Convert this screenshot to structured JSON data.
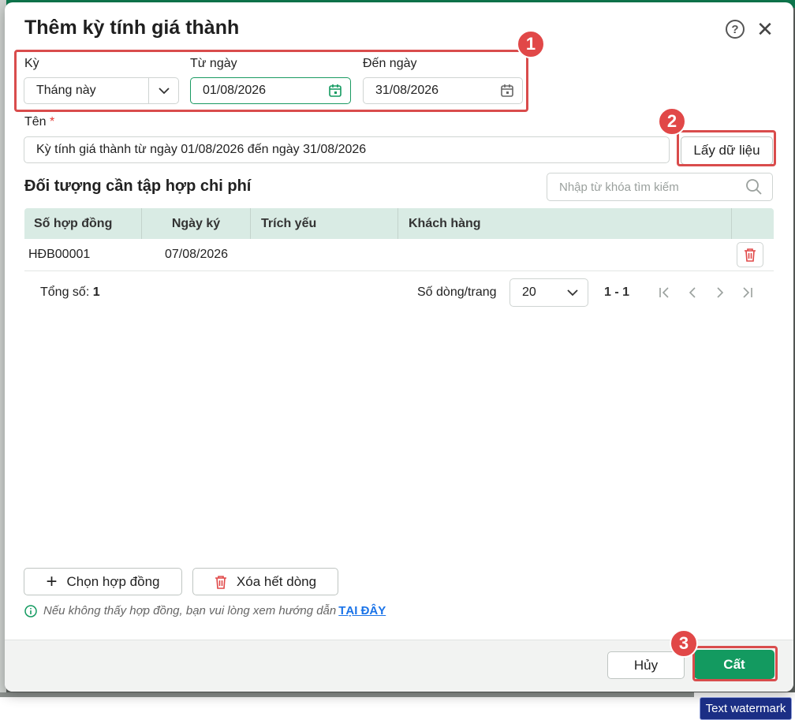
{
  "dialog": {
    "title": "Thêm kỳ tính giá thành",
    "help_icon": "?",
    "close_icon": "✕"
  },
  "period": {
    "ky_label": "Kỳ",
    "ky_value": "Tháng này",
    "from_label": "Từ ngày",
    "from_value": "01/08/2026",
    "to_label": "Đến ngày",
    "to_value": "31/08/2026"
  },
  "name": {
    "label": "Tên",
    "required_mark": "*",
    "value": "Kỳ tính giá thành từ ngày 01/08/2026 đến ngày 31/08/2026",
    "fetch_button": "Lấy dữ liệu"
  },
  "objects": {
    "section_title": "Đối tượng cần tập hợp chi phí",
    "search_placeholder": "Nhập từ khóa tìm kiếm",
    "columns": [
      "Số hợp đồng",
      "Ngày ký",
      "Trích yếu",
      "Khách hàng"
    ],
    "rows": [
      {
        "so_hop_dong": "HĐB00001",
        "ngay_ky": "07/08/2026",
        "trich_yeu": "",
        "khach_hang": ""
      }
    ]
  },
  "pager": {
    "total_label": "Tổng số:",
    "total_value": "1",
    "rows_per_page_label": "Số dòng/trang",
    "rows_per_page_value": "20",
    "range": "1 - 1"
  },
  "actions": {
    "choose_contract": "Chọn hợp đồng",
    "delete_all": "Xóa hết dòng"
  },
  "hint": {
    "text": "Nếu không thấy hợp đồng, bạn vui lòng xem hướng dẫn",
    "link": "TẠI ĐÂY"
  },
  "footer": {
    "cancel": "Hủy",
    "save": "Cất"
  },
  "annotations": {
    "badge1": "1",
    "badge2": "2",
    "badge3": "3"
  },
  "watermark": "Text watermark",
  "colors": {
    "primary": "#139a60",
    "highlight": "#d94c4c",
    "table_header": "#d9ebe4",
    "link": "#1a73e8"
  }
}
